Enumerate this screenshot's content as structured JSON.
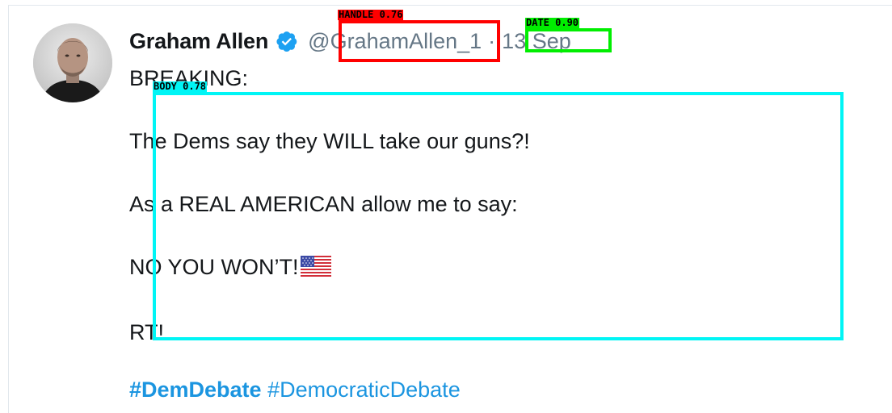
{
  "tweet": {
    "display_name": "Graham Allen",
    "handle": "@GrahamAllen_1",
    "separator": "·",
    "date": "13 Sep",
    "body": [
      "BREAKING:",
      "The Dems say they WILL take our guns?!",
      "As a REAL AMERICAN allow me to say:",
      "NO YOU WON’T!",
      "RT!"
    ],
    "flag_emoji": "us-flag-icon",
    "hashtags": [
      "#DemDebate",
      "#DemocraticDebate"
    ]
  },
  "detections": [
    {
      "label": "HANDLE 0.76",
      "color": "#ff0000"
    },
    {
      "label": "DATE 0.90",
      "color": "#00ee00"
    },
    {
      "label": "BODY 0.78",
      "color": "#00f5f5"
    }
  ],
  "colors": {
    "text": "#14171a",
    "secondary": "#657786",
    "link": "#1b95e0",
    "verified": "#1da1f2"
  }
}
